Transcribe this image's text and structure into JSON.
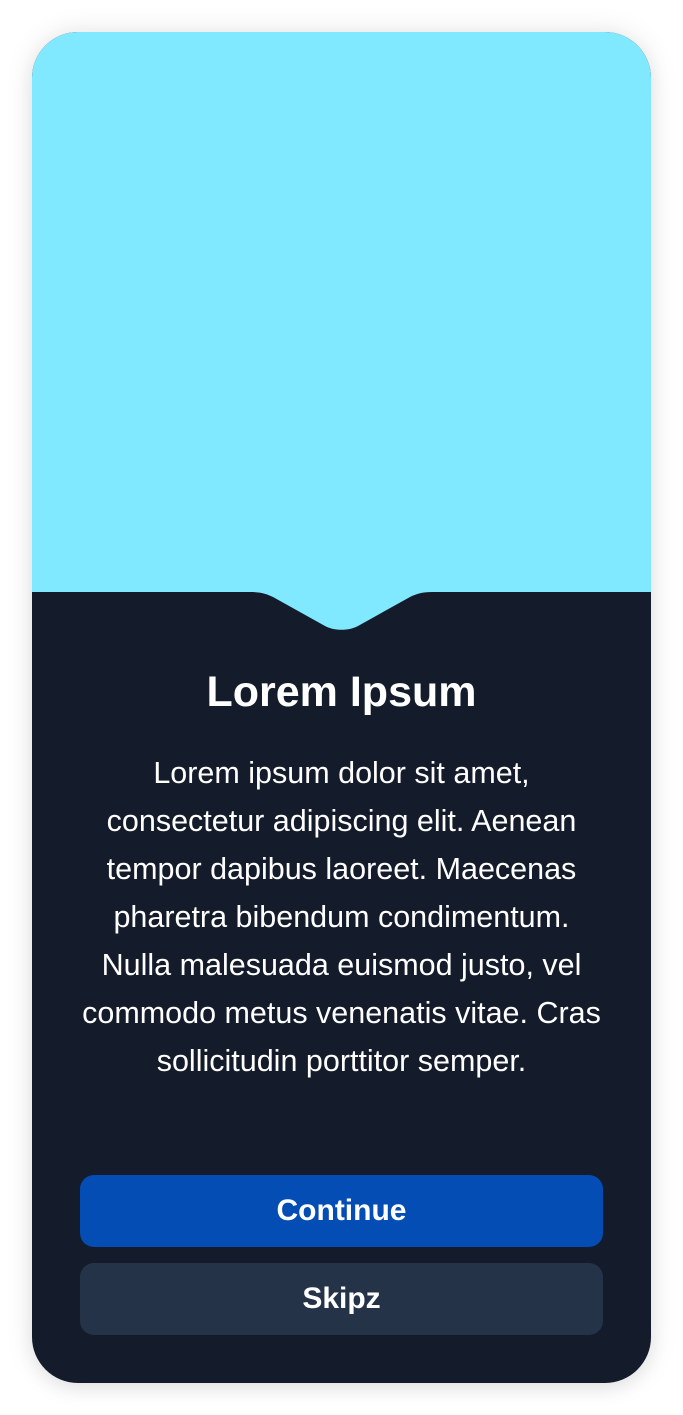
{
  "dialog": {
    "title": "Lorem Ipsum",
    "body": "Lorem ipsum dolor sit amet, consectetur adipiscing elit. Aenean tempor dapibus laoreet. Maecenas pharetra bibendum condimentum. Nulla malesuada euismod justo, vel commodo metus venenatis vitae. Cras sollicitudin porttitor semper.",
    "primary_button_label": "Continue",
    "secondary_button_label": "Skipz"
  },
  "colors": {
    "hero": "#80e8ff",
    "card_background": "#141c2b",
    "primary_button": "#034db4",
    "secondary_button": "#243347",
    "text": "#ffffff"
  }
}
